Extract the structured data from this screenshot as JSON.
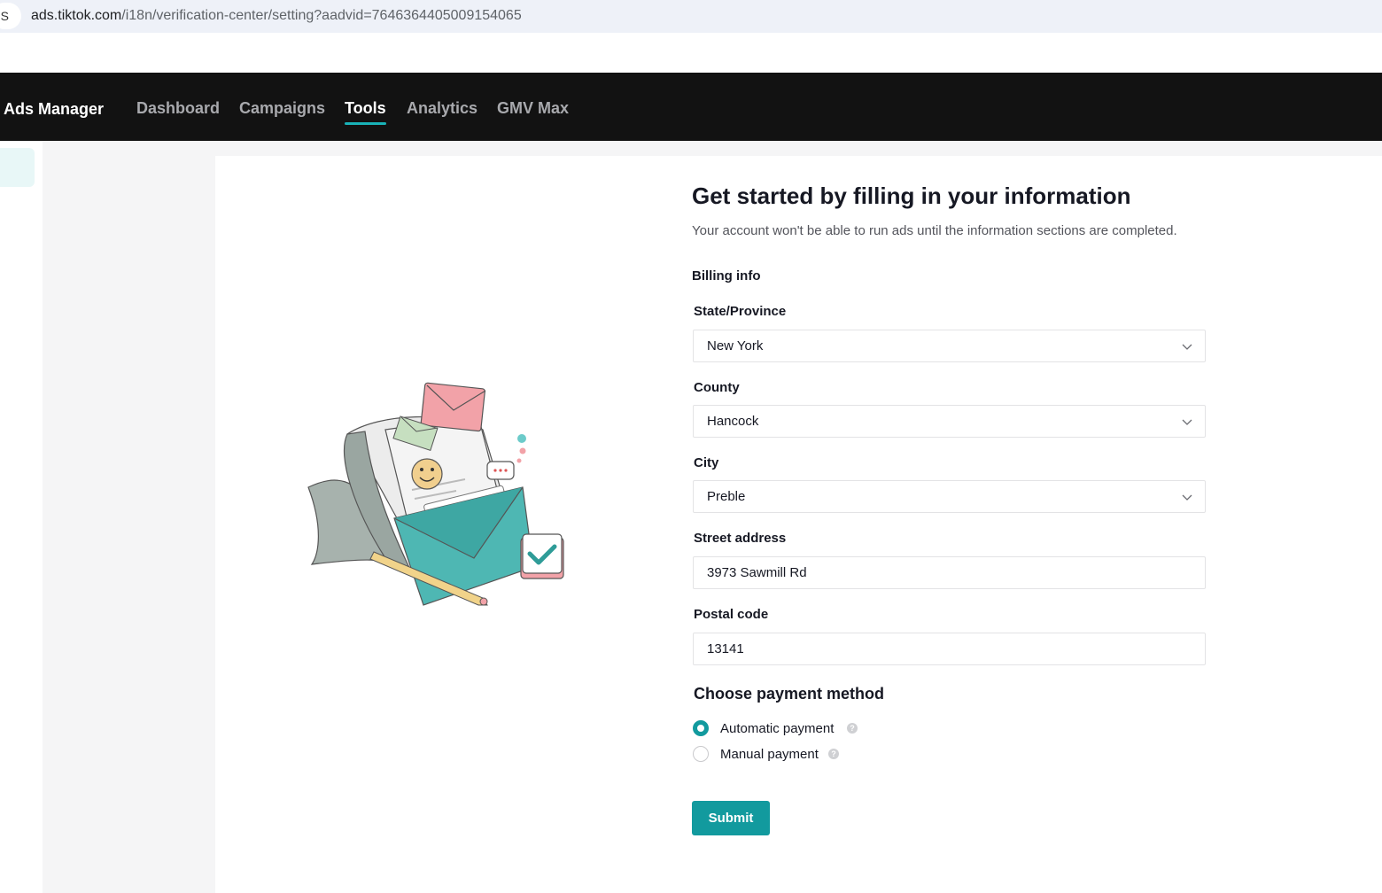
{
  "browser": {
    "site_icon_text": "S",
    "url_host": "ads.tiktok.com",
    "url_path": "/i18n/verification-center/setting?aadvid=7646364405009154065"
  },
  "nav": {
    "brand": "Ads Manager",
    "items": [
      {
        "label": "Dashboard",
        "active": false
      },
      {
        "label": "Campaigns",
        "active": false
      },
      {
        "label": "Tools",
        "active": true
      },
      {
        "label": "Analytics",
        "active": false
      },
      {
        "label": "GMV Max",
        "active": false
      }
    ]
  },
  "form": {
    "title": "Get started by filling in your information",
    "subtitle": "Your account won't be able to run ads until the information sections are completed.",
    "section": "Billing info",
    "state": {
      "label": "State/Province",
      "value": "New York"
    },
    "county": {
      "label": "County",
      "value": "Hancock"
    },
    "city": {
      "label": "City",
      "value": "Preble"
    },
    "street": {
      "label": "Street address",
      "value": "3973 Sawmill Rd"
    },
    "postal": {
      "label": "Postal code",
      "value": "13141"
    },
    "payment": {
      "title": "Choose payment method",
      "options": [
        {
          "label": "Automatic payment",
          "selected": true
        },
        {
          "label": "Manual payment",
          "selected": false
        }
      ]
    },
    "submit_label": "Submit"
  },
  "colors": {
    "accent": "#129a9e",
    "nav_bg": "#121212",
    "nav_underline": "#19b2b7"
  }
}
